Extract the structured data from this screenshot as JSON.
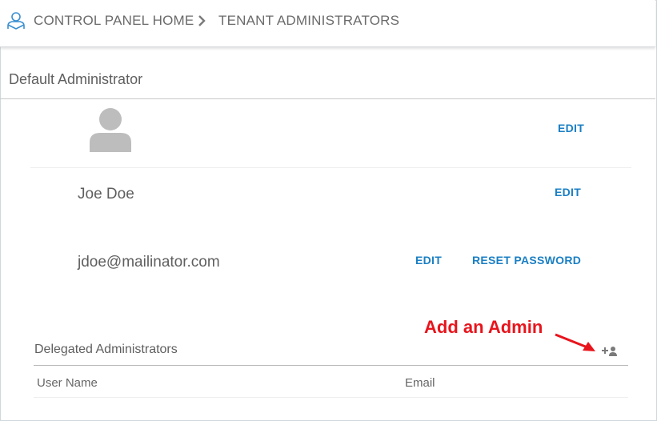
{
  "breadcrumb": {
    "home_label": "CONTROL PANEL HOME",
    "current_label": "TENANT ADMINISTRATORS",
    "icon": "user-home-icon"
  },
  "default_admin": {
    "section_title": "Default Administrator",
    "avatar_icon": "user-avatar-icon",
    "avatar_edit": "EDIT",
    "name": "Joe Doe",
    "name_edit": "EDIT",
    "email": "jdoe@mailinator.com",
    "email_edit": "EDIT",
    "reset_password": "RESET PASSWORD"
  },
  "annotation": {
    "text": "Add an Admin",
    "color": "#e8141c"
  },
  "delegated": {
    "section_title": "Delegated Administrators",
    "add_icon": "add-user-icon",
    "columns": [
      "User Name",
      "Email"
    ]
  },
  "colors": {
    "link": "#1a7fc4",
    "text": "#5f5f5f",
    "avatar": "#bdbdbd"
  }
}
